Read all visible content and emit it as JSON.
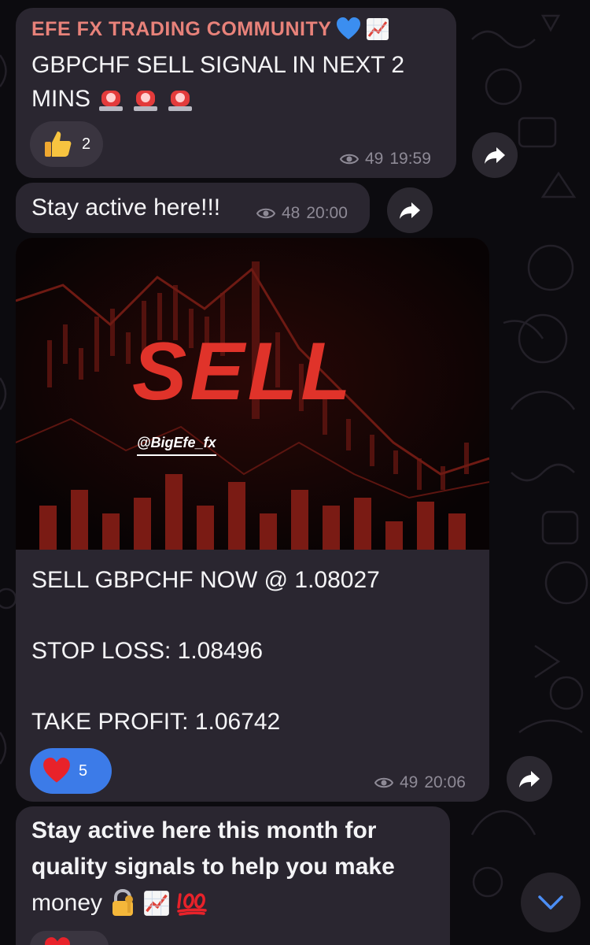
{
  "messages": {
    "m1": {
      "channel_name": "EFE FX TRADING COMMUNITY",
      "line1": "GBPCHF SELL SIGNAL IN NEXT 2",
      "line2": "MINS",
      "reaction_count": "2",
      "views": "49",
      "time": "19:59"
    },
    "m2": {
      "text": "Stay active here!!!",
      "views": "48",
      "time": "20:00"
    },
    "m3": {
      "image_title": "SELL",
      "image_handle": "@BigEfe_fx",
      "line1": "SELL GBPCHF NOW @ 1.08027",
      "line2": "STOP LOSS: 1.08496",
      "line3": "TAKE PROFIT: 1.06742",
      "reaction_count": "5",
      "views": "49",
      "time": "20:06"
    },
    "m4": {
      "line1": "Stay active here this month for",
      "line2": "quality signals to help you make",
      "line3": "money"
    }
  },
  "colors": {
    "bubble": "#2a2630",
    "accent_name": "#e8827a",
    "reaction_selected": "#3c7be8",
    "sell_red": "#e0332a"
  },
  "icons": [
    "thumbs-up-emoji",
    "blue-heart-emoji",
    "chart-increasing-emoji",
    "police-light-emoji",
    "eye-icon",
    "forward-icon",
    "red-heart-emoji",
    "lock-with-key-emoji",
    "hundred-points-emoji",
    "chevron-down-icon"
  ]
}
